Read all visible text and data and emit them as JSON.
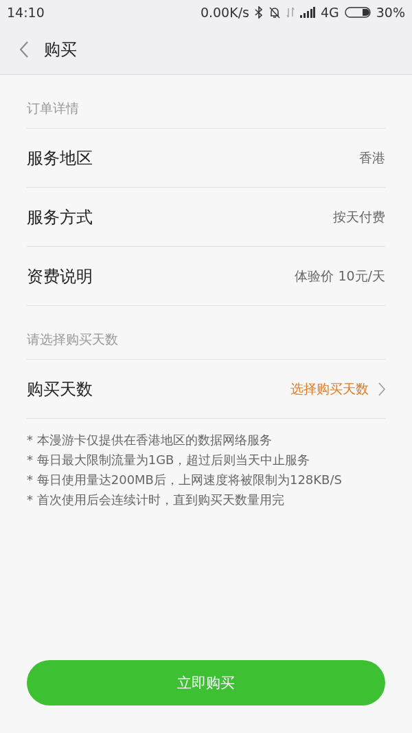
{
  "status_bar": {
    "time": "14:10",
    "speed": "0.00K/s",
    "network": "4G",
    "battery": "30%"
  },
  "header": {
    "title": "购买"
  },
  "sections": [
    {
      "label": "订单详情",
      "rows": [
        {
          "kind": "info",
          "label": "服务地区",
          "value": "香港"
        },
        {
          "kind": "info",
          "label": "服务方式",
          "value": "按天付费"
        },
        {
          "kind": "info",
          "label": "资费说明",
          "value": "体验价 10元/天"
        }
      ]
    },
    {
      "label": "请选择购买天数",
      "rows": [
        {
          "kind": "select",
          "label": "购买天数",
          "value": "选择购买天数"
        }
      ]
    }
  ],
  "notes": [
    "* 本漫游卡仅提供在香港地区的数据网络服务",
    "* 每日最大限制流量为1GB，超过后则当天中止服务",
    "* 每日使用量达200MB后，上网速度将被限制为128KB/S",
    "* 首次使用后会连续计时，直到购买天数量用完"
  ],
  "buy_button": "立即购买"
}
